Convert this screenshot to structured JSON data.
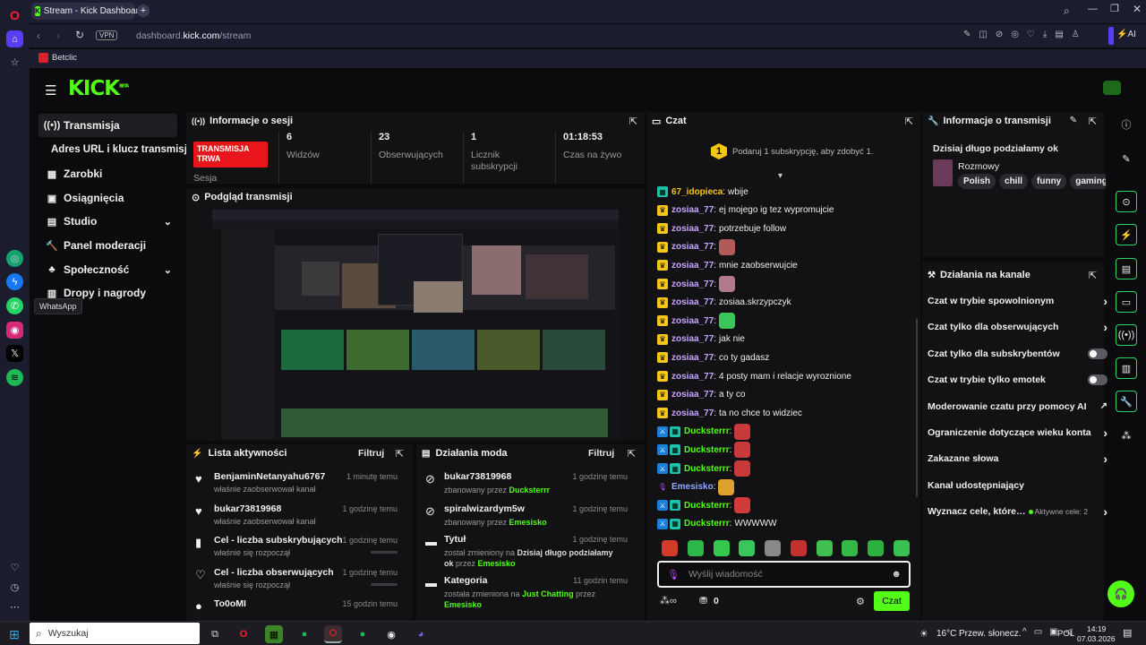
{
  "browser": {
    "tab_title": "Stream - Kick Dashboard",
    "url_prefix": "dashboard.",
    "url_domain": "kick.com",
    "url_path": "/stream",
    "vpn_label": "VPN",
    "ai_label": "AI",
    "bookmark": "Betclic",
    "tooltip": "WhatsApp"
  },
  "kick": {
    "logo": "KICK",
    "logo_beta": "BETA",
    "colors": {
      "accent": "#53fc18",
      "live": "#e8161b",
      "panel": "#121215"
    }
  },
  "nav": {
    "items": [
      {
        "label": "Transmisja",
        "icon": "broadcast-icon"
      },
      {
        "label": "Adres URL i klucz transmisji"
      },
      {
        "label": "Zarobki",
        "icon": "wallet-icon"
      },
      {
        "label": "Osiągnięcia",
        "icon": "trophy-icon"
      },
      {
        "label": "Studio",
        "icon": "studio-icon"
      },
      {
        "label": "Panel moderacji",
        "icon": "hammer-icon"
      },
      {
        "label": "Społeczność",
        "icon": "community-icon"
      },
      {
        "label": "Dropy i nagrody",
        "icon": "gift-icon"
      }
    ]
  },
  "session": {
    "title": "Informacje o sesji",
    "status_line1": "TRANSMISJA",
    "status_line2": "TRWA",
    "status_caption": "Sesja",
    "stats": [
      {
        "value": "6",
        "label": "Widzów"
      },
      {
        "value": "23",
        "label": "Obserwujących"
      },
      {
        "value": "1",
        "label": "Licznik subskrypcji"
      },
      {
        "value": "01:18:53",
        "label": "Czas na żywo"
      }
    ]
  },
  "preview": {
    "title": "Podgląd transmisji"
  },
  "activity": {
    "title": "Lista aktywności",
    "filter": "Filtruj",
    "rows": [
      {
        "name": "BenjaminNetanyahu6767",
        "sub": "właśnie zaobserwował kanał",
        "time": "1 minutę temu",
        "icon": "heart-icon"
      },
      {
        "name": "bukar73819968",
        "sub": "właśnie zaobserwował kanał",
        "time": "1 godzinę temu",
        "icon": "heart-icon"
      },
      {
        "name": "Cel - liczba subskrybujących",
        "sub": "właśnie się rozpoczął",
        "time": "1 godzinę temu",
        "icon": "goal-icon"
      },
      {
        "name": "Cel - liczba obserwujących",
        "sub": "właśnie się rozpoczął",
        "time": "1 godzinę temu",
        "icon": "heart-outline-icon"
      },
      {
        "name": "To0oMI",
        "sub": "",
        "time": "15 godzin temu",
        "icon": "user-icon"
      }
    ]
  },
  "modactions": {
    "title": "Działania moda",
    "filter": "Filtruj",
    "rows": [
      {
        "name": "bukar73819968",
        "sub_pre": "zbanowany przez ",
        "sub_user": "Ducksterrr",
        "time": "1 godzinę temu"
      },
      {
        "name": "spiralwizardym5w",
        "sub_pre": "zbanowany przez ",
        "sub_user": "Emesisko",
        "time": "1 godzinę temu"
      },
      {
        "name": "Tytuł",
        "sub_pre": "został zmieniony na ",
        "sub_bold": "Dzisiaj długo podziałamy ok",
        "sub_mid": " przez ",
        "sub_user": "Emesisko",
        "time": "1 godzinę temu"
      },
      {
        "name": "Kategoria",
        "sub_pre": "została zmieniona na ",
        "sub_user": "Just Chatting",
        "sub_mid": " przez ",
        "sub_user2": "Emesisko",
        "time": "11 godzin temu"
      }
    ]
  },
  "chat": {
    "title": "Czat",
    "sub_goal_num": "1",
    "sub_goal_text": "Podaruj 1 subskrypcję, aby zdobyć 1.",
    "messages": [
      {
        "user": "67_idopieca",
        "color": "#f5c518",
        "text": "wbije"
      },
      {
        "user": "zosiaa_77",
        "color": "#c7a6ff",
        "text": "ej mojego ig tez wypromujcie"
      },
      {
        "user": "zosiaa_77",
        "color": "#c7a6ff",
        "text": "potrzebuje follow"
      },
      {
        "user": "zosiaa_77",
        "color": "#c7a6ff",
        "text": ""
      },
      {
        "user": "zosiaa_77",
        "color": "#c7a6ff",
        "text": "mnie zaobserwujcie"
      },
      {
        "user": "zosiaa_77",
        "color": "#c7a6ff",
        "text": ""
      },
      {
        "user": "zosiaa_77",
        "color": "#c7a6ff",
        "text": "zosiaa.skrzypczyk"
      },
      {
        "user": "zosiaa_77",
        "color": "#c7a6ff",
        "text": ""
      },
      {
        "user": "zosiaa_77",
        "color": "#c7a6ff",
        "text": "jak nie"
      },
      {
        "user": "zosiaa_77",
        "color": "#c7a6ff",
        "text": "co ty gadasz"
      },
      {
        "user": "zosiaa_77",
        "color": "#c7a6ff",
        "text": "4 posty mam i relacje wyroznione"
      },
      {
        "user": "zosiaa_77",
        "color": "#c7a6ff",
        "text": "a ty co"
      },
      {
        "user": "zosiaa_77",
        "color": "#c7a6ff",
        "text": "ta no chce to widziec"
      },
      {
        "user": "Ducksterrr",
        "color": "#53fc18",
        "text": ""
      },
      {
        "user": "Ducksterrr",
        "color": "#53fc18",
        "text": ""
      },
      {
        "user": "Ducksterrr",
        "color": "#53fc18",
        "text": ""
      },
      {
        "user": "Emesisko",
        "color": "#8fa8ff",
        "text": ""
      },
      {
        "user": "Ducksterrr",
        "color": "#53fc18",
        "text": ""
      },
      {
        "user": "Ducksterrr",
        "color": "#53fc18",
        "text": "WWWWW"
      }
    ],
    "placeholder": "Wyślij wiadomość",
    "points": "0",
    "send": "Czat"
  },
  "streaminfo": {
    "title": "Informacje o transmisji",
    "stream_title": "Dzisiaj długo podziałamy ok",
    "category": "Rozmowy",
    "tags": [
      "Polish",
      "chill",
      "funny",
      "gaming"
    ]
  },
  "channel": {
    "title": "Działania na kanale",
    "rows": [
      {
        "label": "Czat w trybie spowolnionym",
        "ctl": "chevron"
      },
      {
        "label": "Czat tylko dla obserwujących",
        "ctl": "chevron"
      },
      {
        "label": "Czat tylko dla subskrybentów",
        "ctl": "toggle"
      },
      {
        "label": "Czat w trybie tylko emotek",
        "ctl": "toggle"
      },
      {
        "label": "Moderowanie czatu przy pomocy AI",
        "ctl": "external"
      },
      {
        "label": "Ograniczenie dotyczące wieku konta",
        "ctl": "chevron"
      },
      {
        "label": "Zakazane słowa",
        "ctl": "chevron"
      },
      {
        "label": "Kanał udostępniający",
        "ctl": "none"
      },
      {
        "label": "Wyznacz cele, które…",
        "ctl": "chevron",
        "extra": "Aktywne cele: 2"
      }
    ]
  },
  "taskbar": {
    "search": "Wyszukaj",
    "weather": "16°C",
    "weather_text": "Przew. słonecz.",
    "lang": "POL",
    "time": "14:19",
    "date": "07.03.2026"
  }
}
